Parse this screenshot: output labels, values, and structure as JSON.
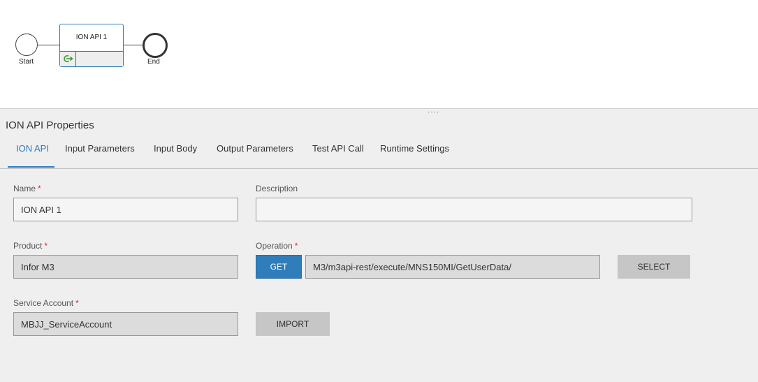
{
  "diagram": {
    "start_label": "Start",
    "end_label": "End",
    "api_node_title": "ION API 1",
    "api_node_icon": "refresh-arrow-icon",
    "accent_color": "#2f7bb3"
  },
  "panel": {
    "title": "ION API Properties",
    "tabs": [
      {
        "label": "ION API",
        "active": true
      },
      {
        "label": "Input Parameters",
        "active": false
      },
      {
        "label": "Input Body",
        "active": false
      },
      {
        "label": "Output Parameters",
        "active": false
      },
      {
        "label": "Test API Call",
        "active": false
      },
      {
        "label": "Runtime Settings",
        "active": false
      }
    ],
    "accent_color": "#2b7bbf"
  },
  "form": {
    "name": {
      "label": "Name",
      "value": "ION API 1",
      "required": "*"
    },
    "description": {
      "label": "Description",
      "value": ""
    },
    "product": {
      "label": "Product",
      "value": "Infor M3",
      "required": "*"
    },
    "operation": {
      "label": "Operation",
      "required": "*",
      "method": "GET",
      "value": "M3/m3api-rest/execute/MNS150MI/GetUserData/"
    },
    "select_button": "SELECT",
    "service_account": {
      "label": "Service Account",
      "value": "MBJJ_ServiceAccount",
      "required": "*"
    },
    "import_button": "IMPORT"
  }
}
